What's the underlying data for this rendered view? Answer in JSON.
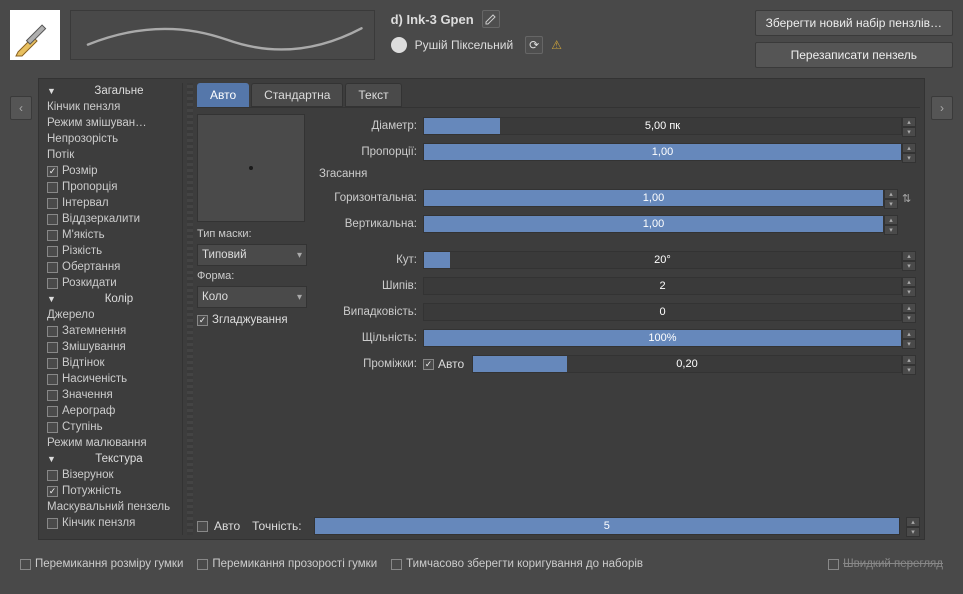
{
  "header": {
    "brush_name": "d) Ink-3 Gpen",
    "engine": "Рушій Піксельний",
    "save_new": "Зберегти новий набір пензлів…",
    "overwrite": "Перезаписати пензель"
  },
  "tabs": {
    "auto": "Авто",
    "standard": "Стандартна",
    "text": "Текст"
  },
  "sidebar": {
    "cat_general": "Загальне",
    "tip": "Кінчик пензля",
    "blend": "Режим змішуван…",
    "opacity": "Непрозорість",
    "flow": "Потік",
    "size": "Розмір",
    "ratio": "Пропорція",
    "spacing": "Інтервал",
    "mirror": "Віддзеркалити",
    "softness": "М'якість",
    "sharpness": "Різкість",
    "rotation": "Обертання",
    "scatter": "Розкидати",
    "cat_color": "Колір",
    "source": "Джерело",
    "darken": "Затемнення",
    "mix": "Змішування",
    "hue": "Відтінок",
    "saturation": "Насиченість",
    "value": "Значення",
    "airbrush": "Аерограф",
    "rate": "Ступінь",
    "paintmode": "Режим малювання",
    "cat_texture": "Текстура",
    "pattern": "Візерунок",
    "strength": "Потужність",
    "mask_brush": "Маскувальний пензель",
    "mask_tip": "Кінчик пензля"
  },
  "left": {
    "mask_type": "Тип маски:",
    "mask_type_val": "Типовий",
    "shape": "Форма:",
    "shape_val": "Коло",
    "antialias": "Згладжування"
  },
  "params": {
    "diameter_lbl": "Діаметр:",
    "diameter": "5,00 пк",
    "ratio_lbl": "Пропорції:",
    "ratio": "1,00",
    "fade": "Згасання",
    "horiz_lbl": "Горизонтальна:",
    "horiz": "1,00",
    "vert_lbl": "Вертикальна:",
    "vert": "1,00",
    "angle_lbl": "Кут:",
    "angle": "20°",
    "spikes_lbl": "Шипів:",
    "spikes": "2",
    "random_lbl": "Випадковість:",
    "random": "0",
    "density_lbl": "Щільність:",
    "density": "100%",
    "spacing_lbl": "Проміжки:",
    "spacing_auto": "Авто",
    "spacing": "0,20",
    "bottom_auto": "Авто",
    "precision_lbl": "Точність:",
    "precision": "5"
  },
  "footer": {
    "eraser_size": "Перемикання розміру гумки",
    "eraser_opacity": "Перемикання прозорості гумки",
    "temp_save": "Тимчасово зберегти коригування до наборів",
    "quick": "Швидкий перегляд"
  }
}
